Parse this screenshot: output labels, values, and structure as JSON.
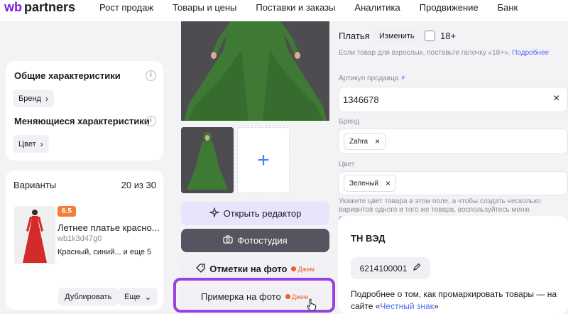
{
  "header": {
    "logo_wb": "wb",
    "logo_partners": "partners",
    "nav": [
      "Рост продаж",
      "Товары и цены",
      "Поставки и заказы",
      "Аналитика",
      "Продвижение",
      "Банк"
    ]
  },
  "characteristics": {
    "general_title": "Общие характеристики",
    "brand_chip": "Бренд",
    "changing_title": "Меняющиеся характеристики",
    "color_chip": "Цвет"
  },
  "variants": {
    "title": "Варианты",
    "count": "20 из 30",
    "badge": "6.5",
    "product_name": "Летнее платье красно...",
    "sku": "wb1k3d47g0",
    "colors": "Красный, синий...",
    "more": "и еще 5",
    "duplicate_label": "Дублировать",
    "more_button_label": "Еще"
  },
  "media": {
    "add_icon": "+",
    "editor_label": "Открыть редактор",
    "studio_label": "Фотостудия",
    "marks_label": "Отметки на фото",
    "marks_tag": "Джем",
    "tryon_label": "Примерка на фото",
    "tryon_tag": "Джем"
  },
  "form": {
    "category": "Платья",
    "change_label": "Изменить",
    "adult_label": "18+",
    "adult_hint": "Если товар для взрослых, поставьте галочку «18+».",
    "adult_hint_link": "Подробнее",
    "article_label": "Артикул продавца",
    "article_value": "1346678",
    "brand_label": "Бренд",
    "brand_value": "Zahra",
    "color_label": "Цвет",
    "color_value": "Зеленый",
    "color_hint": "Укажите цвет товара в этом поле, а чтобы создать несколько вариантов одного и того же товара, воспользуйтесь меню слева."
  },
  "tnved": {
    "title": "ТН ВЭД",
    "code": "6214100001",
    "info_text": "Подробнее о том, как промаркировать товары — на сайте «",
    "info_link": "Честный знак",
    "info_end": "»"
  },
  "colors": {
    "brand_purple": "#7a1fd1",
    "highlight": "#9a3fe0",
    "link": "#4a6cf7",
    "dress_green": "#3f7a35",
    "dress_red": "#d42a2a",
    "jam_orange": "#f05a24"
  }
}
